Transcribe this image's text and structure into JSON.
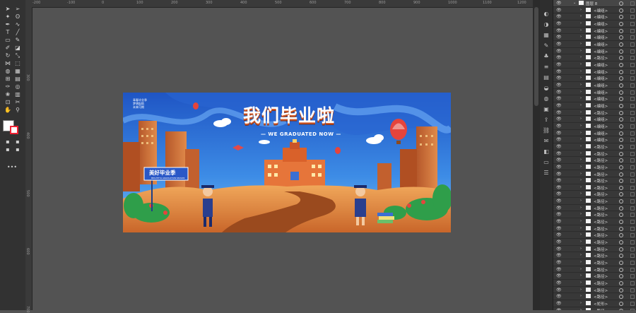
{
  "toolbar": {
    "tools": [
      {
        "icon": "selection-icon",
        "glyph": "➤"
      },
      {
        "icon": "direct-selection-icon",
        "glyph": "➢"
      },
      {
        "icon": "magic-wand-icon",
        "glyph": "✦"
      },
      {
        "icon": "lasso-icon",
        "glyph": "ʘ"
      },
      {
        "icon": "pen-icon",
        "glyph": "✒"
      },
      {
        "icon": "curvature-icon",
        "glyph": "∿"
      },
      {
        "icon": "type-icon",
        "glyph": "T"
      },
      {
        "icon": "line-segment-icon",
        "glyph": "╱"
      },
      {
        "icon": "rectangle-icon",
        "glyph": "▭"
      },
      {
        "icon": "paintbrush-icon",
        "glyph": "✎"
      },
      {
        "icon": "shaper-icon",
        "glyph": "✐"
      },
      {
        "icon": "eraser-icon",
        "glyph": "◪"
      },
      {
        "icon": "rotate-icon",
        "glyph": "↻"
      },
      {
        "icon": "scale-icon",
        "glyph": "⤡"
      },
      {
        "icon": "width-icon",
        "glyph": "⋈"
      },
      {
        "icon": "free-transform-icon",
        "glyph": "⬚"
      },
      {
        "icon": "shape-builder-icon",
        "glyph": "◍"
      },
      {
        "icon": "perspective-grid-icon",
        "glyph": "▦"
      },
      {
        "icon": "mesh-icon",
        "glyph": "⊞"
      },
      {
        "icon": "gradient-icon",
        "glyph": "▤"
      },
      {
        "icon": "eyedropper-icon",
        "glyph": "✑"
      },
      {
        "icon": "blend-icon",
        "glyph": "◎"
      },
      {
        "icon": "symbol-sprayer-icon",
        "glyph": "❀"
      },
      {
        "icon": "column-graph-icon",
        "glyph": "▥"
      },
      {
        "icon": "artboard-icon",
        "glyph": "⊡"
      },
      {
        "icon": "slice-icon",
        "glyph": "✂"
      },
      {
        "icon": "hand-icon",
        "glyph": "✋"
      },
      {
        "icon": "zoom-icon",
        "glyph": "⚲"
      }
    ],
    "more_label": "•••"
  },
  "rulers": {
    "top_ticks": [
      "-200",
      "-100",
      "0",
      "100",
      "200",
      "300",
      "400",
      "500",
      "600",
      "700",
      "800",
      "900",
      "1000",
      "1100",
      "1200"
    ],
    "left_ticks": [
      "300",
      "400",
      "500",
      "600",
      "700"
    ]
  },
  "panel_icons": [
    "color-icon",
    "color-guide-icon",
    "swatches-icon",
    "brushes-icon",
    "symbols-icon",
    "stroke-icon",
    "gradient-icon",
    "transparency-icon",
    "appearance-icon",
    "graphic-styles-icon",
    "export-icon",
    "links-icon",
    "comments-icon",
    "layers-icon",
    "artboards-icon",
    "properties-icon"
  ],
  "layers": {
    "top_layer": "图层 8",
    "rows": [
      "<编组>",
      "<编组>",
      "<编组>",
      "<编组>",
      "<编组>",
      "<编组>",
      "<编组>",
      "<路径>",
      "<编组>",
      "<编组>",
      "<编组>",
      "<编组>",
      "<编组>",
      "<编组>",
      "<编组>",
      "<路径>",
      "<编组>",
      "<编组>",
      "<编组>",
      "<编组>",
      "<路径>",
      "<路径>",
      "<路径>",
      "<路径>",
      "<路径>",
      "<路径>",
      "<路径>",
      "<路径>",
      "<路径>",
      "<路径>",
      "<路径>",
      "<路径>",
      "<路径>",
      "<路径>",
      "<路径>",
      "<路径>",
      "<路径>",
      "<路径>",
      "<路径>",
      "<路径>",
      "<路径>",
      "<路径>",
      "<路径>",
      "<矩形>",
      "<路径>"
    ]
  },
  "artwork": {
    "title_cn": "我们毕业啦",
    "title_en": "— WE GRADUATED NOW —",
    "logo_text": "青春毕业季\n梦想起航\n未来可期",
    "sign_cn": "美好毕业季",
    "sign_en": "BEAUTIFUL GRADUATION SEASON"
  }
}
